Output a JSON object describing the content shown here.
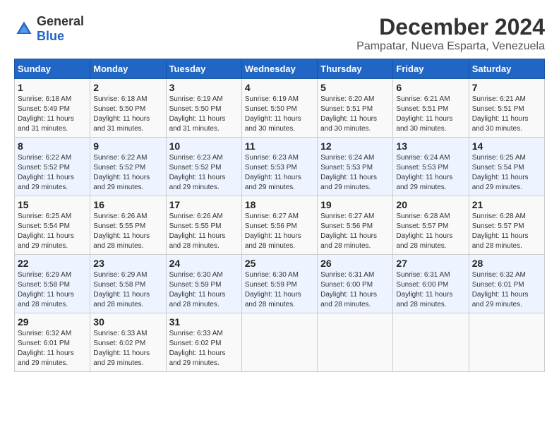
{
  "logo": {
    "text_general": "General",
    "text_blue": "Blue"
  },
  "header": {
    "title": "December 2024",
    "subtitle": "Pampatar, Nueva Esparta, Venezuela"
  },
  "days_of_week": [
    "Sunday",
    "Monday",
    "Tuesday",
    "Wednesday",
    "Thursday",
    "Friday",
    "Saturday"
  ],
  "weeks": [
    [
      {
        "day": "1",
        "sunrise": "Sunrise: 6:18 AM",
        "sunset": "Sunset: 5:49 PM",
        "daylight": "Daylight: 11 hours and 31 minutes."
      },
      {
        "day": "2",
        "sunrise": "Sunrise: 6:18 AM",
        "sunset": "Sunset: 5:50 PM",
        "daylight": "Daylight: 11 hours and 31 minutes."
      },
      {
        "day": "3",
        "sunrise": "Sunrise: 6:19 AM",
        "sunset": "Sunset: 5:50 PM",
        "daylight": "Daylight: 11 hours and 31 minutes."
      },
      {
        "day": "4",
        "sunrise": "Sunrise: 6:19 AM",
        "sunset": "Sunset: 5:50 PM",
        "daylight": "Daylight: 11 hours and 30 minutes."
      },
      {
        "day": "5",
        "sunrise": "Sunrise: 6:20 AM",
        "sunset": "Sunset: 5:51 PM",
        "daylight": "Daylight: 11 hours and 30 minutes."
      },
      {
        "day": "6",
        "sunrise": "Sunrise: 6:21 AM",
        "sunset": "Sunset: 5:51 PM",
        "daylight": "Daylight: 11 hours and 30 minutes."
      },
      {
        "day": "7",
        "sunrise": "Sunrise: 6:21 AM",
        "sunset": "Sunset: 5:51 PM",
        "daylight": "Daylight: 11 hours and 30 minutes."
      }
    ],
    [
      {
        "day": "8",
        "sunrise": "Sunrise: 6:22 AM",
        "sunset": "Sunset: 5:52 PM",
        "daylight": "Daylight: 11 hours and 29 minutes."
      },
      {
        "day": "9",
        "sunrise": "Sunrise: 6:22 AM",
        "sunset": "Sunset: 5:52 PM",
        "daylight": "Daylight: 11 hours and 29 minutes."
      },
      {
        "day": "10",
        "sunrise": "Sunrise: 6:23 AM",
        "sunset": "Sunset: 5:52 PM",
        "daylight": "Daylight: 11 hours and 29 minutes."
      },
      {
        "day": "11",
        "sunrise": "Sunrise: 6:23 AM",
        "sunset": "Sunset: 5:53 PM",
        "daylight": "Daylight: 11 hours and 29 minutes."
      },
      {
        "day": "12",
        "sunrise": "Sunrise: 6:24 AM",
        "sunset": "Sunset: 5:53 PM",
        "daylight": "Daylight: 11 hours and 29 minutes."
      },
      {
        "day": "13",
        "sunrise": "Sunrise: 6:24 AM",
        "sunset": "Sunset: 5:53 PM",
        "daylight": "Daylight: 11 hours and 29 minutes."
      },
      {
        "day": "14",
        "sunrise": "Sunrise: 6:25 AM",
        "sunset": "Sunset: 5:54 PM",
        "daylight": "Daylight: 11 hours and 29 minutes."
      }
    ],
    [
      {
        "day": "15",
        "sunrise": "Sunrise: 6:25 AM",
        "sunset": "Sunset: 5:54 PM",
        "daylight": "Daylight: 11 hours and 29 minutes."
      },
      {
        "day": "16",
        "sunrise": "Sunrise: 6:26 AM",
        "sunset": "Sunset: 5:55 PM",
        "daylight": "Daylight: 11 hours and 28 minutes."
      },
      {
        "day": "17",
        "sunrise": "Sunrise: 6:26 AM",
        "sunset": "Sunset: 5:55 PM",
        "daylight": "Daylight: 11 hours and 28 minutes."
      },
      {
        "day": "18",
        "sunrise": "Sunrise: 6:27 AM",
        "sunset": "Sunset: 5:56 PM",
        "daylight": "Daylight: 11 hours and 28 minutes."
      },
      {
        "day": "19",
        "sunrise": "Sunrise: 6:27 AM",
        "sunset": "Sunset: 5:56 PM",
        "daylight": "Daylight: 11 hours and 28 minutes."
      },
      {
        "day": "20",
        "sunrise": "Sunrise: 6:28 AM",
        "sunset": "Sunset: 5:57 PM",
        "daylight": "Daylight: 11 hours and 28 minutes."
      },
      {
        "day": "21",
        "sunrise": "Sunrise: 6:28 AM",
        "sunset": "Sunset: 5:57 PM",
        "daylight": "Daylight: 11 hours and 28 minutes."
      }
    ],
    [
      {
        "day": "22",
        "sunrise": "Sunrise: 6:29 AM",
        "sunset": "Sunset: 5:58 PM",
        "daylight": "Daylight: 11 hours and 28 minutes."
      },
      {
        "day": "23",
        "sunrise": "Sunrise: 6:29 AM",
        "sunset": "Sunset: 5:58 PM",
        "daylight": "Daylight: 11 hours and 28 minutes."
      },
      {
        "day": "24",
        "sunrise": "Sunrise: 6:30 AM",
        "sunset": "Sunset: 5:59 PM",
        "daylight": "Daylight: 11 hours and 28 minutes."
      },
      {
        "day": "25",
        "sunrise": "Sunrise: 6:30 AM",
        "sunset": "Sunset: 5:59 PM",
        "daylight": "Daylight: 11 hours and 28 minutes."
      },
      {
        "day": "26",
        "sunrise": "Sunrise: 6:31 AM",
        "sunset": "Sunset: 6:00 PM",
        "daylight": "Daylight: 11 hours and 28 minutes."
      },
      {
        "day": "27",
        "sunrise": "Sunrise: 6:31 AM",
        "sunset": "Sunset: 6:00 PM",
        "daylight": "Daylight: 11 hours and 28 minutes."
      },
      {
        "day": "28",
        "sunrise": "Sunrise: 6:32 AM",
        "sunset": "Sunset: 6:01 PM",
        "daylight": "Daylight: 11 hours and 29 minutes."
      }
    ],
    [
      {
        "day": "29",
        "sunrise": "Sunrise: 6:32 AM",
        "sunset": "Sunset: 6:01 PM",
        "daylight": "Daylight: 11 hours and 29 minutes."
      },
      {
        "day": "30",
        "sunrise": "Sunrise: 6:33 AM",
        "sunset": "Sunset: 6:02 PM",
        "daylight": "Daylight: 11 hours and 29 minutes."
      },
      {
        "day": "31",
        "sunrise": "Sunrise: 6:33 AM",
        "sunset": "Sunset: 6:02 PM",
        "daylight": "Daylight: 11 hours and 29 minutes."
      },
      null,
      null,
      null,
      null
    ]
  ]
}
